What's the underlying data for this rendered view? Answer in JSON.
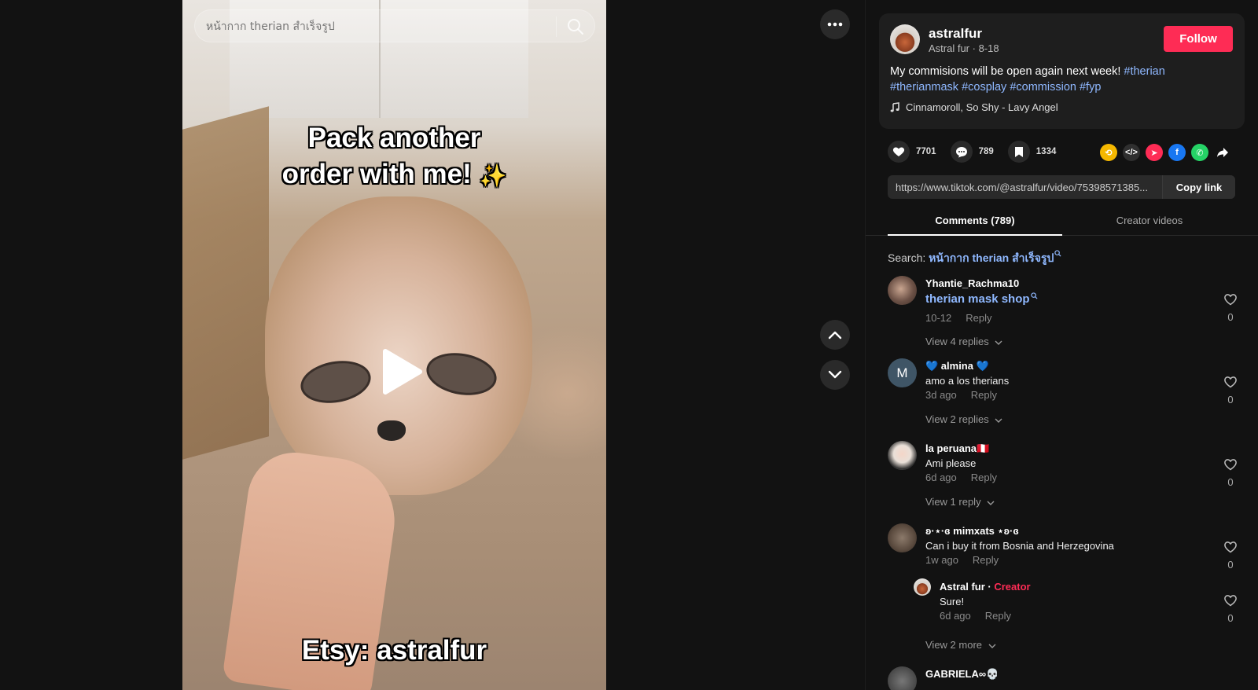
{
  "search": {
    "placeholder": "หน้ากาก therian สำเร็จรูป"
  },
  "video": {
    "overlay_top_line1": "Pack another",
    "overlay_top_line2": "order with me!",
    "overlay_bottom": "Etsy: astralfur"
  },
  "author": {
    "username": "astralfur",
    "meta": "Astral fur · 8-18",
    "follow_label": "Follow"
  },
  "caption": {
    "text": "My commisions will be open again next week!",
    "hashtags": [
      "#therian",
      "#therianmask",
      "#cosplay",
      "#commission",
      "#fyp"
    ]
  },
  "music": {
    "title": "Cinnamoroll, So Shy - Lavy Angel"
  },
  "stats": {
    "likes": "7701",
    "comments": "789",
    "saves": "1334"
  },
  "link": {
    "url": "https://www.tiktok.com/@astralfur/video/75398571385...",
    "copy_label": "Copy link"
  },
  "tabs": {
    "comments": "Comments (789)",
    "creator": "Creator videos"
  },
  "search_suggestion": {
    "label": "Search:",
    "term": "หน้ากาก therian สำเร็จรูป"
  },
  "comments": [
    {
      "user": "Yhantie_Rachma10",
      "text": "therian mask shop",
      "date": "10-12",
      "reply": "Reply",
      "replies": "View 4 replies",
      "likes": "0"
    },
    {
      "user": "💙 almina 💙",
      "avatar_letter": "M",
      "text": "amo a los therians",
      "date": "3d ago",
      "reply": "Reply",
      "replies": "View 2 replies",
      "likes": "0"
    },
    {
      "user": "la peruana🇵🇪",
      "text": "Ami please",
      "date": "6d ago",
      "reply": "Reply",
      "replies": "View 1 reply",
      "likes": "0"
    },
    {
      "user": "ʚ·⋆·ɞ mimxats ⋆ʚ·ɞ",
      "text": "Can i buy it from Bosnia and Herzegovina",
      "date": "1w ago",
      "reply": "Reply",
      "likes": "0"
    },
    {
      "user": "GABRIELA∞💀"
    }
  ],
  "nested_reply": {
    "user": "Astral fur",
    "tag": "Creator",
    "text": "Sure!",
    "date": "6d ago",
    "reply": "Reply",
    "likes": "0",
    "more": "View 2 more"
  },
  "colors": {
    "accent": "#fe2c55",
    "hashtag": "#8fb8ff",
    "background": "#121212"
  }
}
